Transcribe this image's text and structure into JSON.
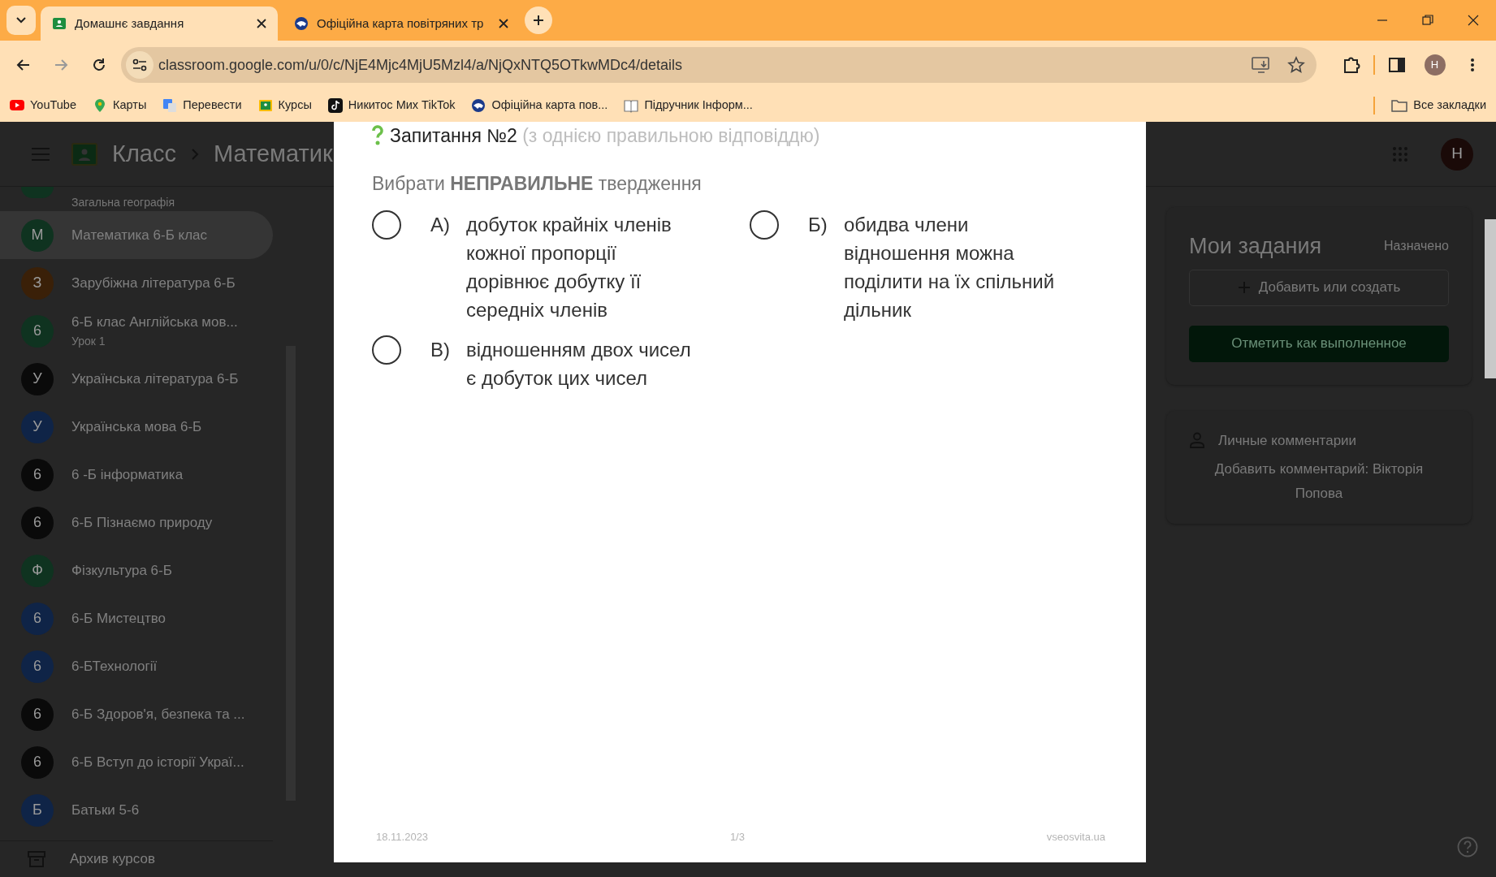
{
  "browser": {
    "tabs": [
      {
        "title": "Домашнє завдання",
        "selected": true
      },
      {
        "title": "Офіційна карта повітряних тр",
        "selected": false
      }
    ],
    "address": "classroom.google.com/u/0/c/NjE4Mjc4MjU5Mzl4/a/NjQxNTQ5OTkwMDc4/details",
    "profile": "H",
    "bookmarks": [
      {
        "label": "YouTube"
      },
      {
        "label": "Карты"
      },
      {
        "label": "Перевести"
      },
      {
        "label": "Курсы"
      },
      {
        "label": "Никитос Мих TikTok"
      },
      {
        "label": "Офіційна карта пов..."
      },
      {
        "label": "Підручник Інформ..."
      }
    ],
    "all_bookmarks": "Все закладки"
  },
  "app": {
    "brand": "Класс",
    "breadcrumb": "Математик",
    "avatar": "H"
  },
  "sidebar": {
    "cut_item": {
      "subtitle": "Загальна географія"
    },
    "items": [
      {
        "initial": "М",
        "name": "Математика 6-Б клас",
        "color": "#0f3320",
        "selected": true
      },
      {
        "initial": "З",
        "name": "Зарубіжна література 6-Б",
        "color": "#3a2008",
        "selected": false
      },
      {
        "initial": "6",
        "name": "6-Б клас Англійська мов...",
        "subtitle": "Урок 1",
        "color": "#0f3320",
        "selected": false
      },
      {
        "initial": "У",
        "name": "Українська література 6-Б",
        "color": "#0a0a0a",
        "selected": false
      },
      {
        "initial": "У",
        "name": "Українська мова 6-Б",
        "color": "#0f2447",
        "selected": false
      },
      {
        "initial": "6",
        "name": "6 -Б інформатика",
        "color": "#0a0a0a",
        "selected": false
      },
      {
        "initial": "6",
        "name": "6-Б Пізнаємо природу",
        "color": "#0a0a0a",
        "selected": false
      },
      {
        "initial": "Ф",
        "name": "Фізкультура 6-Б",
        "color": "#0f3320",
        "selected": false
      },
      {
        "initial": "6",
        "name": "6-Б Мистецтво",
        "color": "#0f2447",
        "selected": false
      },
      {
        "initial": "6",
        "name": "6-БТехнології",
        "color": "#0f2447",
        "selected": false
      },
      {
        "initial": "6",
        "name": "6-Б Здоров'я, безпека та ...",
        "color": "#0a0a0a",
        "selected": false
      },
      {
        "initial": "6",
        "name": "6-Б Вступ до історії Украї...",
        "color": "#0a0a0a",
        "selected": false
      },
      {
        "initial": "Б",
        "name": "Батьки 5-6",
        "color": "#0f2447",
        "selected": false
      }
    ],
    "archive": "Архив курсов"
  },
  "right_panel": {
    "title": "Мои задания",
    "status": "Назначено",
    "add_button": "Добавить или создать",
    "done_button": "Отметить как выполненное",
    "comments_title": "Личные комментарии",
    "comment_link": "Добавить комментарий: Вікторія Попова"
  },
  "document": {
    "question": "Запитання №2",
    "question_note": "(з однією правильною відповіддю)",
    "prompt": "Вибрати **НЕПРАВИЛЬНЕ** твердження",
    "options": [
      {
        "letter": "А)",
        "text": "добуток крайніх членів\nкожної пропорції\nдорівнює добутку її\nсередніх членів",
        "selected": false
      },
      {
        "letter": "Б)",
        "text": "обидва члени\nвідношення можна\nподілити на їх спільний\nдільник",
        "selected": false
      },
      {
        "letter": "В)",
        "text": "відношенням двох чисел\nє добуток цих чисел",
        "selected": false
      }
    ],
    "footer": {
      "date": "18.11.2023",
      "page": "1/3",
      "site": "vseosvita.ua"
    }
  }
}
